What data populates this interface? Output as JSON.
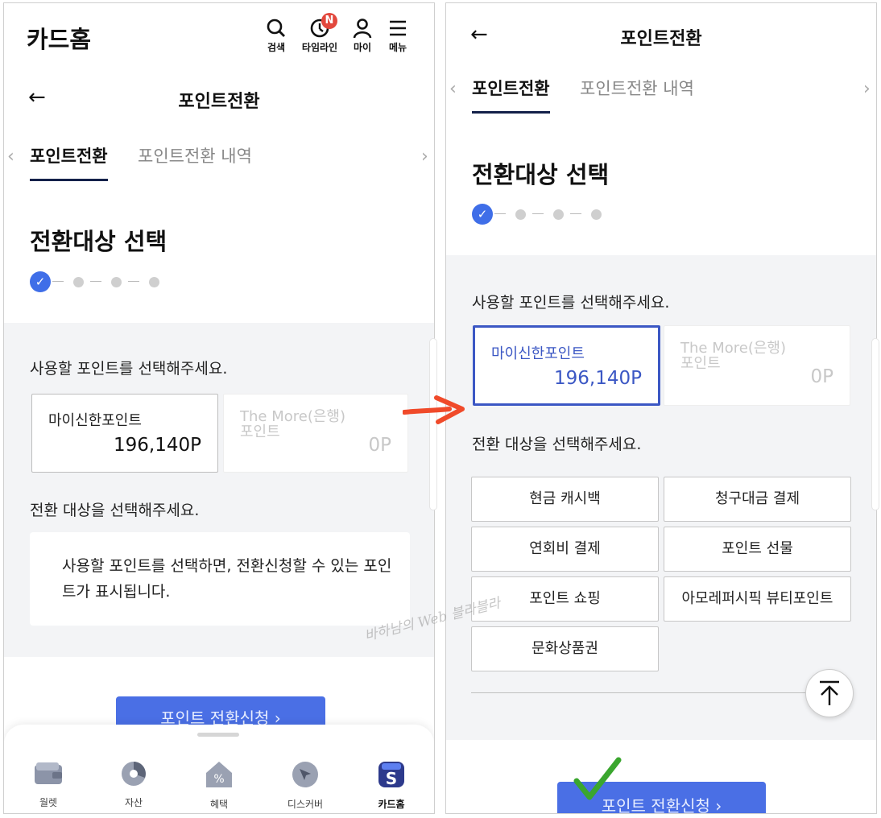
{
  "left": {
    "home_title": "카드홈",
    "header_icons": [
      {
        "label": "검색",
        "icon": "search-icon"
      },
      {
        "label": "타임라인",
        "icon": "timeline-icon",
        "badge": "N"
      },
      {
        "label": "마이",
        "icon": "person-icon"
      },
      {
        "label": "메뉴",
        "icon": "menu-icon"
      }
    ],
    "nav": {
      "back": "←",
      "title": "포인트전환"
    },
    "tabs": {
      "active": "포인트전환",
      "inactive": "포인트전환 내역",
      "prev": "‹",
      "next": "›"
    },
    "section_title": "전환대상 선택",
    "step_check": "✓",
    "prompt_points": "사용할 포인트를 선택해주세요.",
    "cards": [
      {
        "name": "마이신한포인트",
        "value": "196,140P"
      },
      {
        "name": "The More(은행) 포인트",
        "value": "0P"
      }
    ],
    "prompt_target": "전환 대상을 선택해주세요.",
    "info_text": "사용할 포인트를 선택하면, 전환신청할 수 있는 포인트가 표시됩니다.",
    "apply_button": "포인트 전환신청 ›",
    "bottom_nav": [
      {
        "label": "월렛",
        "icon": "wallet-icon"
      },
      {
        "label": "자산",
        "icon": "pie-chart-icon"
      },
      {
        "label": "혜택",
        "icon": "coupon-icon"
      },
      {
        "label": "디스커버",
        "icon": "compass-icon"
      },
      {
        "label": "카드홈",
        "icon": "card-home-icon",
        "active": true
      }
    ]
  },
  "right": {
    "nav": {
      "back": "←",
      "title": "포인트전환"
    },
    "tabs": {
      "active": "포인트전환",
      "inactive": "포인트전환 내역",
      "prev": "‹",
      "next": "›"
    },
    "section_title": "전환대상 선택",
    "step_check": "✓",
    "prompt_points": "사용할 포인트를 선택해주세요.",
    "cards": [
      {
        "name": "마이신한포인트",
        "value": "196,140P",
        "selected": true
      },
      {
        "name": "The More(은행) 포인트",
        "value": "0P"
      }
    ],
    "prompt_target": "전환 대상을 선택해주세요.",
    "options": [
      "현금 캐시백",
      "청구대금 결제",
      "연회비 결제",
      "포인트 선물",
      "포인트 쇼핑",
      "아모레퍼시픽 뷰티포인트",
      "문화상품권"
    ],
    "apply_button": "포인트 전환신청 ›"
  },
  "watermark": "바하남의 Web 블라블라",
  "colors": {
    "accent": "#3f6ee8",
    "selected_border": "#3b57c4",
    "tab_underline": "#14214a",
    "badge": "#e2483d",
    "arrow": "#f04a2a",
    "check": "#3aa62e"
  }
}
